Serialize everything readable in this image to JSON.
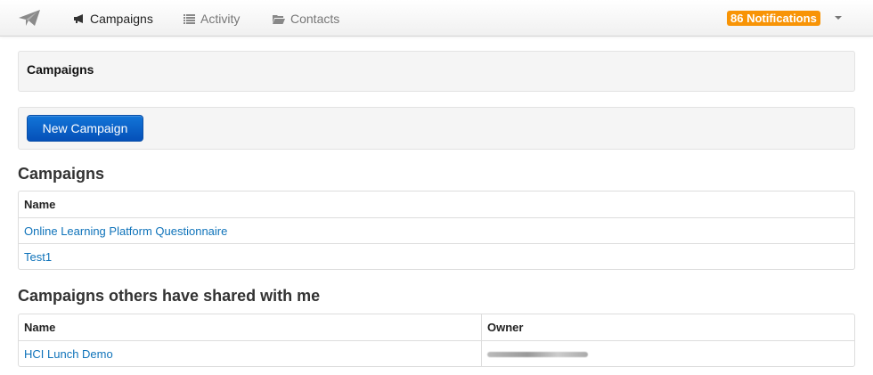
{
  "navbar": {
    "brand_icon": "paper-plane-icon",
    "items": [
      {
        "label": "Campaigns",
        "icon": "bullhorn-icon",
        "active": true
      },
      {
        "label": "Activity",
        "icon": "list-icon",
        "active": false
      },
      {
        "label": "Contacts",
        "icon": "folder-icon",
        "active": false
      }
    ],
    "notifications": "86 Notifications",
    "colors": {
      "notification_badge": "#f89406"
    }
  },
  "header_well": {
    "title": "Campaigns"
  },
  "actions_well": {
    "new_campaign_button": "New Campaign",
    "button_color": "#0550b8"
  },
  "my_campaigns": {
    "heading": "Campaigns",
    "columns": [
      "Name"
    ],
    "rows": [
      "Online Learning Platform Questionnaire",
      "Test1"
    ]
  },
  "shared_campaigns": {
    "heading": "Campaigns others have shared with me",
    "columns": [
      "Name",
      "Owner"
    ],
    "rows": [
      {
        "name": "HCI Lunch Demo",
        "owner": ""
      }
    ]
  }
}
